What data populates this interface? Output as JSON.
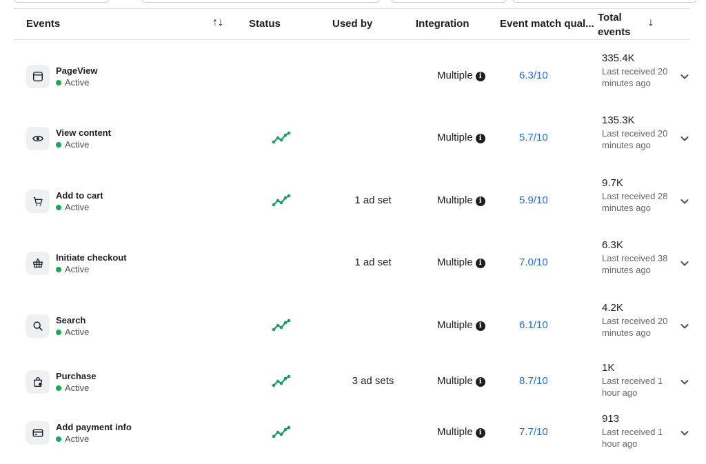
{
  "table": {
    "headers": {
      "events": "Events",
      "status": "Status",
      "used_by": "Used by",
      "integration": "Integration",
      "event_match_quality": "Event match qual...",
      "total_events_line1": "Total",
      "total_events_line2": "events"
    },
    "rows": [
      {
        "name": "PageView",
        "status": "Active",
        "icon": "browser-window-icon",
        "used_by": "",
        "integration": "Multiple",
        "emq": "6.3/10",
        "total": "335.4K",
        "last_received": "Last received 20 minutes ago",
        "has_trend": false
      },
      {
        "name": "View content",
        "status": "Active",
        "icon": "eye-icon",
        "used_by": "",
        "integration": "Multiple",
        "emq": "5.7/10",
        "total": "135.3K",
        "last_received": "Last received 20 minutes ago",
        "has_trend": true
      },
      {
        "name": "Add to cart",
        "status": "Active",
        "icon": "cart-icon",
        "used_by": "1 ad set",
        "integration": "Multiple",
        "emq": "5.9/10",
        "total": "9.7K",
        "last_received": "Last received 28 minutes ago",
        "has_trend": true
      },
      {
        "name": "Initiate checkout",
        "status": "Active",
        "icon": "basket-icon",
        "used_by": "1 ad set",
        "integration": "Multiple",
        "emq": "7.0/10",
        "total": "6.3K",
        "last_received": "Last received 38 minutes ago",
        "has_trend": false
      },
      {
        "name": "Search",
        "status": "Active",
        "icon": "search-icon",
        "used_by": "",
        "integration": "Multiple",
        "emq": "6.1/10",
        "total": "4.2K",
        "last_received": "Last received 20 minutes ago",
        "has_trend": true
      },
      {
        "name": "Purchase",
        "status": "Active",
        "icon": "shopping-bag-icon",
        "used_by": "3 ad sets",
        "integration": "Multiple",
        "emq": "8.7/10",
        "total": "1K",
        "last_received": "Last received 1 hour ago",
        "has_trend": true
      },
      {
        "name": "Add payment info",
        "status": "Active",
        "icon": "credit-card-icon",
        "used_by": "",
        "integration": "Multiple",
        "emq": "7.7/10",
        "total": "913",
        "last_received": "Last received 1 hour ago",
        "has_trend": true
      }
    ]
  },
  "colors": {
    "active_dot": "#1aaa55",
    "trend": "#1a9a6e",
    "link": "#216fdb",
    "muted_text": "#65676b"
  }
}
